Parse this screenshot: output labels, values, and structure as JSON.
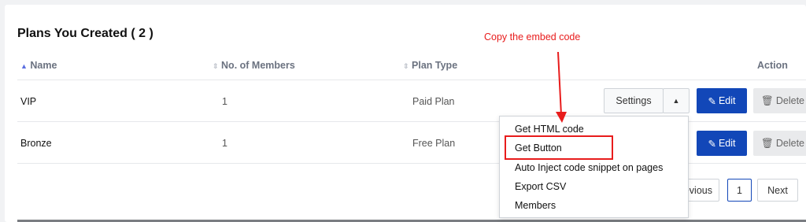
{
  "title": "Plans You Created ( 2 )",
  "columns": {
    "name": "Name",
    "members": "No. of Members",
    "type": "Plan Type",
    "action": "Action"
  },
  "rows": [
    {
      "name": "VIP",
      "members": "1",
      "type": "Paid Plan"
    },
    {
      "name": "Bronze",
      "members": "1",
      "type": "Free Plan"
    }
  ],
  "actions": {
    "settings": "Settings",
    "edit": "Edit",
    "delete": "Delete"
  },
  "dropdown": [
    "Get HTML code",
    "Get Button",
    "Auto Inject code snippet on pages",
    "Export CSV",
    "Members"
  ],
  "pagination": {
    "previous": "Previous",
    "current": "1",
    "next": "Next"
  },
  "annotation": "Copy the embed code",
  "colors": {
    "primary": "#1247b8",
    "annotation": "#e81c1c"
  }
}
